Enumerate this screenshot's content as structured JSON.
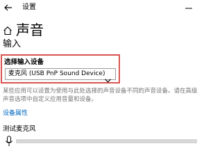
{
  "window": {
    "title": "设置",
    "back_icon": "back-arrow-icon",
    "minimize_icon": "minimize-icon"
  },
  "page": {
    "home_icon": "home-icon",
    "title": "声音"
  },
  "input_section": {
    "heading": "输入",
    "choose_device_label": "选择输入设备",
    "selected_device": "麦克风 (USB PnP Sound Device)",
    "dropdown_icon": "chevron-down-icon",
    "description_lines": [
      "某些应用可以设置为使用与此处选择的声音设备不同的声音设备。请在高级",
      "声音选项中自定义应用音量和设备。"
    ],
    "device_properties_link": "设备属性",
    "test_mic_label": "测试麦克风",
    "mic_icon": "microphone-icon",
    "mic_level": 0
  },
  "colors": {
    "highlight_border": "#d9534f",
    "link": "#0067c0",
    "muted_text": "#767676"
  }
}
